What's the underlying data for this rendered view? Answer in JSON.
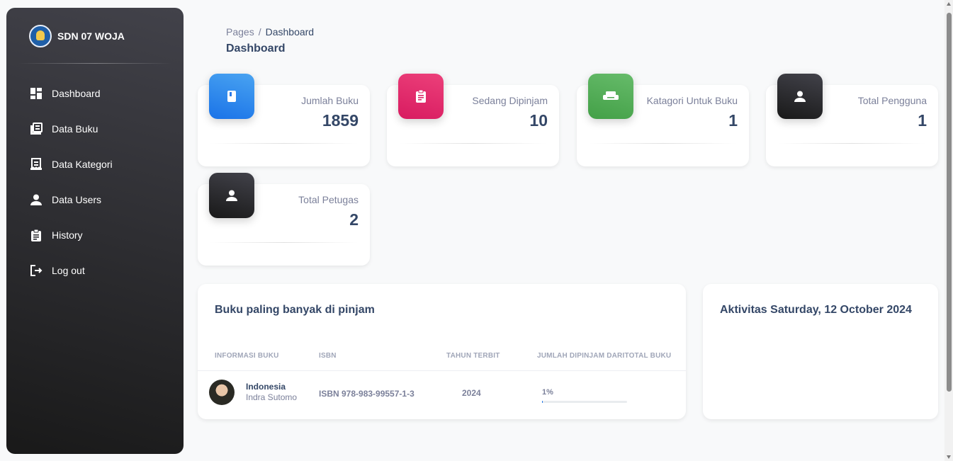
{
  "brand": {
    "name": "SDN 07 WOJA",
    "logo_icon": "school-emblem-icon"
  },
  "sidebar": {
    "items": [
      {
        "label": "Dashboard",
        "icon": "dashboard-icon"
      },
      {
        "label": "Data Buku",
        "icon": "library-books-icon"
      },
      {
        "label": "Data Kategori",
        "icon": "receipt-list-icon"
      },
      {
        "label": "Data Users",
        "icon": "person-icon"
      },
      {
        "label": "History",
        "icon": "clipboard-icon"
      },
      {
        "label": "Log out",
        "icon": "logout-icon"
      }
    ]
  },
  "breadcrumb": {
    "root": "Pages",
    "separator": "/",
    "current": "Dashboard"
  },
  "page": {
    "title": "Dashboard"
  },
  "stats": [
    {
      "label": "Jumlah Buku",
      "value": "1859",
      "icon": "book-icon",
      "color": "#1a73e8"
    },
    {
      "label": "Sedang Dipinjam",
      "value": "10",
      "icon": "clipboard-icon",
      "color": "#d81b60"
    },
    {
      "label": "Katagori Untuk Buku",
      "value": "1",
      "icon": "weekend-icon",
      "color": "#43a047"
    },
    {
      "label": "Total Pengguna",
      "value": "1",
      "icon": "person-icon",
      "color": "#191919"
    },
    {
      "label": "Total Petugas",
      "value": "2",
      "icon": "person-icon",
      "color": "#191919"
    }
  ],
  "top_books": {
    "title": "Buku paling banyak di pinjam",
    "columns": [
      "INFORMASI BUKU",
      "ISBN",
      "TAHUN TERBIT",
      "JUMLAH DIPINJAM DARITOTAL BUKU"
    ],
    "rows": [
      {
        "title": "Indonesia",
        "author": "Indra Sutomo",
        "isbn": "ISBN 978-983-99557-1-3",
        "year": "2024",
        "percent": "1%",
        "progress": 0.01
      }
    ]
  },
  "activity": {
    "title": "Aktivitas Saturday, 12 October 2024"
  }
}
